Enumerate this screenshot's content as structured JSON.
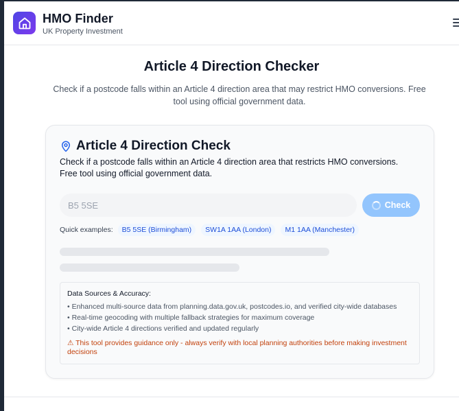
{
  "header": {
    "brand_title": "HMO Finder",
    "brand_subtitle": "UK Property Investment",
    "logo_icon": "house-icon",
    "menu_icon": "hamburger-menu-icon"
  },
  "page": {
    "title": "Article 4 Direction Checker",
    "description": "Check if a postcode falls within an Article 4 direction area that may restrict HMO conversions. Free tool using official government data."
  },
  "checker": {
    "title": "Article 4 Direction Check",
    "title_icon": "map-pin-icon",
    "description": "Check if a postcode falls within an Article 4 direction area that restricts HMO conversions. Free tool using official government data.",
    "input_placeholder": "B5 5SE",
    "input_value": "",
    "check_label": "Check",
    "check_icon": "spinner-icon",
    "quick_label": "Quick examples:",
    "quick_examples": [
      "B5 5SE (Birmingham)",
      "SW1A 1AA (London)",
      "M1 1AA (Manchester)"
    ]
  },
  "sources": {
    "title": "Data Sources & Accuracy:",
    "items": [
      "• Enhanced multi-source data from planning.data.gov.uk, postcodes.io, and verified city-wide databases",
      "• Real-time geocoding with multiple fallback strategies for maximum coverage",
      "• City-wide Article 4 directions verified and updated regularly"
    ],
    "warning": "⚠ This tool provides guidance only - always verify with local planning authorities before making investment decisions"
  },
  "colors": {
    "accent": "#4f46e5",
    "button": "#93c5fd",
    "warning": "#c2410c",
    "chip_text": "#1d4ed8"
  }
}
